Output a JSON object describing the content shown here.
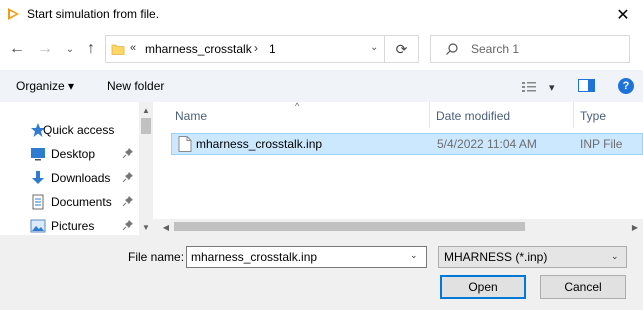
{
  "window": {
    "title": "Start simulation from file.",
    "app_icon": "app-logo-icon",
    "close_glyph": "✕"
  },
  "navigation": {
    "back_glyph": "←",
    "forward_glyph": "→",
    "recent_glyph": "⌄",
    "up_glyph": "↑",
    "refresh_glyph": "⟳"
  },
  "address": {
    "chevrons": "«",
    "crumbs": [
      "mharness_crosstalk",
      "1"
    ],
    "separator": "›",
    "dropdown_glyph": "⌄"
  },
  "search": {
    "placeholder": "Search 1"
  },
  "toolbar": {
    "organize_label": "Organize ▾",
    "new_folder_label": "New folder",
    "view_dropdown_glyph": "▾",
    "help_glyph": "?"
  },
  "nav_pane": {
    "items": [
      {
        "label": "Quick access",
        "icon": "star-icon",
        "pinned": false
      },
      {
        "label": "Desktop",
        "icon": "desktop-icon",
        "pinned": true
      },
      {
        "label": "Downloads",
        "icon": "download-icon",
        "pinned": true
      },
      {
        "label": "Documents",
        "icon": "documents-icon",
        "pinned": true
      },
      {
        "label": "Pictures",
        "icon": "pictures-icon",
        "pinned": true
      }
    ]
  },
  "file_list": {
    "columns": {
      "name": "Name",
      "date": "Date modified",
      "type": "Type"
    },
    "sort_caret": "^",
    "rows": [
      {
        "name": "mharness_crosstalk.inp",
        "date": "5/4/2022 11:04 AM",
        "type": "INP File",
        "selected": true
      }
    ]
  },
  "scroll_glyphs": {
    "up": "▲",
    "down": "▼",
    "left": "◀",
    "right": "▶"
  },
  "footer": {
    "filename_label": "File name:",
    "filename_value": "mharness_crosstalk.inp",
    "filetype_value": "MHARNESS (*.inp)",
    "dropdown_glyph": "⌄",
    "open_label": "Open",
    "cancel_label": "Cancel"
  },
  "colors": {
    "accent": "#0078d7",
    "selection_bg": "#cce8ff",
    "selection_border": "#99d1ff",
    "toolbar_bg": "#f0f4f9",
    "header_text": "#4c607a"
  }
}
